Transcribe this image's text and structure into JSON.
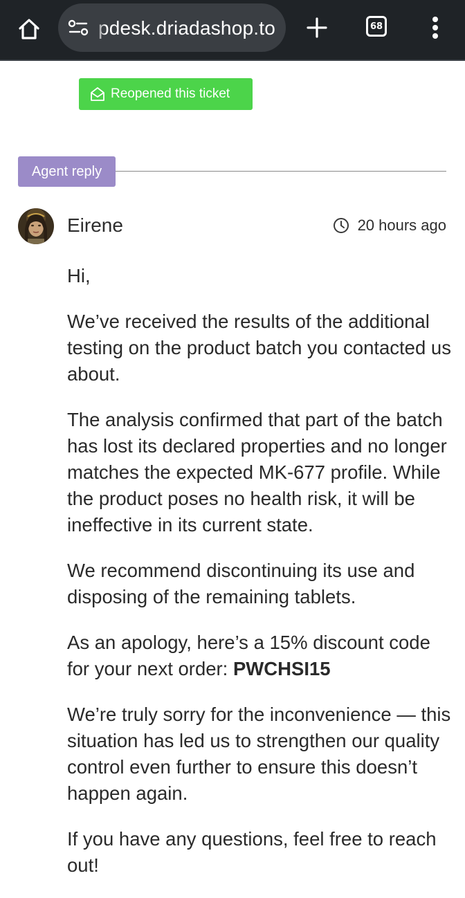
{
  "browser": {
    "url_text": "pdesk.driadashop.to",
    "tab_count": "68"
  },
  "ticket": {
    "reopen_label": "Reopened this ticket",
    "reply_label": "Agent reply",
    "author": "Eirene",
    "time": "20 hours ago",
    "greeting": "Hi,",
    "para1": "We’ve received the results of the additional testing on the product batch you contacted us about.",
    "para2": "The analysis confirmed that part of the batch has lost its declared properties and no longer matches the expected MK-677 profile. While the product poses no health risk, it will be ineffective in its current state.",
    "para3": "We recommend discontinuing its use and disposing of the remaining tablets.",
    "para4_prefix": "As an apology, here’s a 15% discount code for your next order: ",
    "discount_code": "PWCHSI15",
    "para5": "We’re truly sorry for the inconvenience — this situation has led us to strengthen our quality control even further to ensure this doesn’t happen again.",
    "para6": "If you have any questions, feel free to reach out!"
  },
  "colors": {
    "reopen_badge": "#4cd44a",
    "agent_badge": "#9b8bc8",
    "browser_bar": "#1f2327"
  },
  "icons": {
    "home": "home-icon",
    "site_info": "site-settings-icon",
    "new_tab": "plus-icon",
    "menu": "more-vert-icon",
    "reopen": "envelope-open-icon",
    "clock": "clock-icon"
  }
}
